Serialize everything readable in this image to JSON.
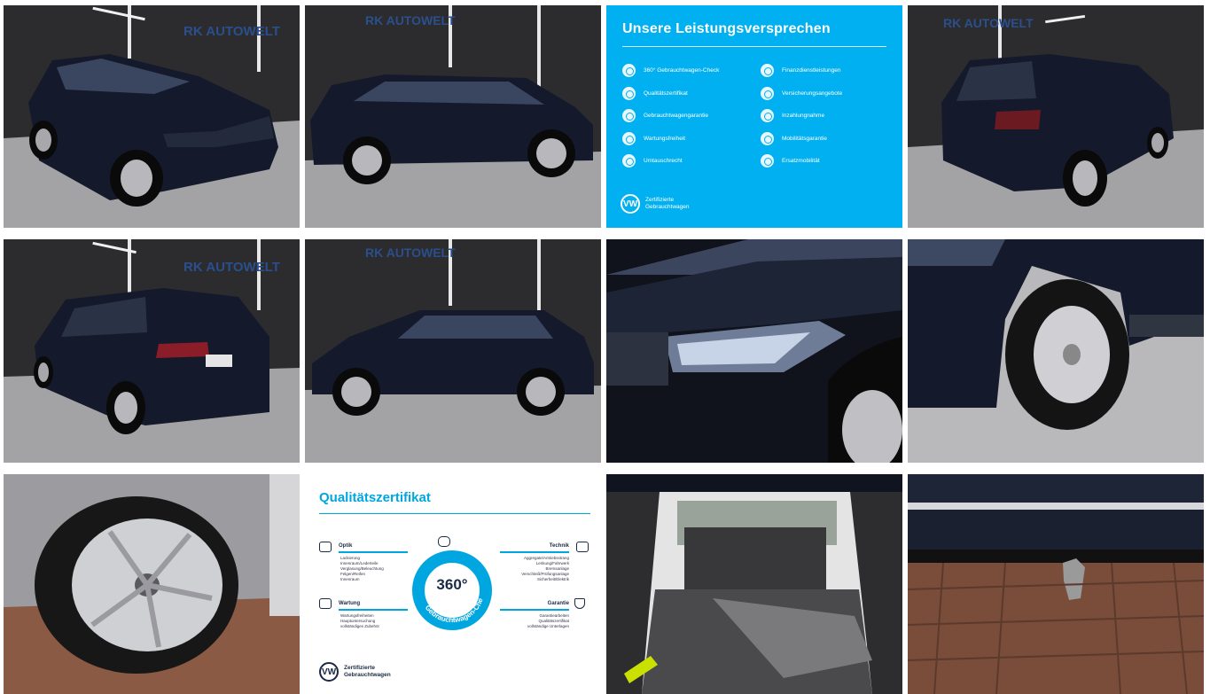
{
  "gallery": {
    "photos": [
      "Tiguan Allspace front three-quarter view in showroom",
      "Tiguan Allspace side view in showroom",
      "Tiguan Allspace rear three-quarter view in showroom",
      "Tiguan Allspace rear left view in showroom",
      "Tiguan Allspace left side view in showroom",
      "Headlight and hood close-up",
      "Rear wheel close-up",
      "Front wheel close-up on paving",
      "Open trunk with third row seats",
      "Tow bar close-up"
    ],
    "dealer_sign": "RK AUTOWELT",
    "promise_card": {
      "title": "Unsere Leistungsversprechen",
      "left_items": [
        "360° Gebrauchtwagen-Check",
        "Qualitätszertifikat",
        "Gebrauchtwagengarantie",
        "Wartungsfreiheit",
        "Umtauschrecht"
      ],
      "right_items": [
        "Finanzdienstleistungen",
        "Versicherungsangebote",
        "Inzahlungnahme",
        "Mobilitätsgarantie",
        "Ersatzmobilität"
      ],
      "footer_line1": "Zertifizierte",
      "footer_line2": "Gebrauchtwagen",
      "logo": "VW"
    },
    "quality_card": {
      "title": "Qualitätszertifikat",
      "center_number": "360°",
      "center_arc_text": "Gebrauchtwagen-Check",
      "optik": {
        "head": "Optik",
        "items": [
          "Lackierung",
          "Innenraum/Lederteile",
          "Verglasung/Beleuchtung",
          "Felgen/Reifen",
          "Innenraum"
        ]
      },
      "technik": {
        "head": "Technik",
        "items": [
          "Aggregate/Antriebsstrang",
          "Lenkung/Fahrwerk",
          "Bremsanlage",
          "Verschleiß/Prüfungsanlage",
          "Sicherheit/Elektrik"
        ]
      },
      "wartung": {
        "head": "Wartung",
        "items": [
          "Wartungsfreiheiten",
          "Hauptuntersuchung",
          "vollständiges Zubehör"
        ]
      },
      "garantie": {
        "head": "Garantie",
        "items": [
          "Garantiearbeiten",
          "Qualitätszertifikat",
          "vollständige Unterlagen"
        ]
      },
      "footer_line1": "Zertifizierte",
      "footer_line2": "Gebrauchtwagen",
      "logo": "VW"
    },
    "colors": {
      "vw_blue": "#00b0f0",
      "car_paint": "#141a2b",
      "showroom_wall": "#2b2b2e",
      "showroom_floor": "#9a9a9c"
    }
  }
}
